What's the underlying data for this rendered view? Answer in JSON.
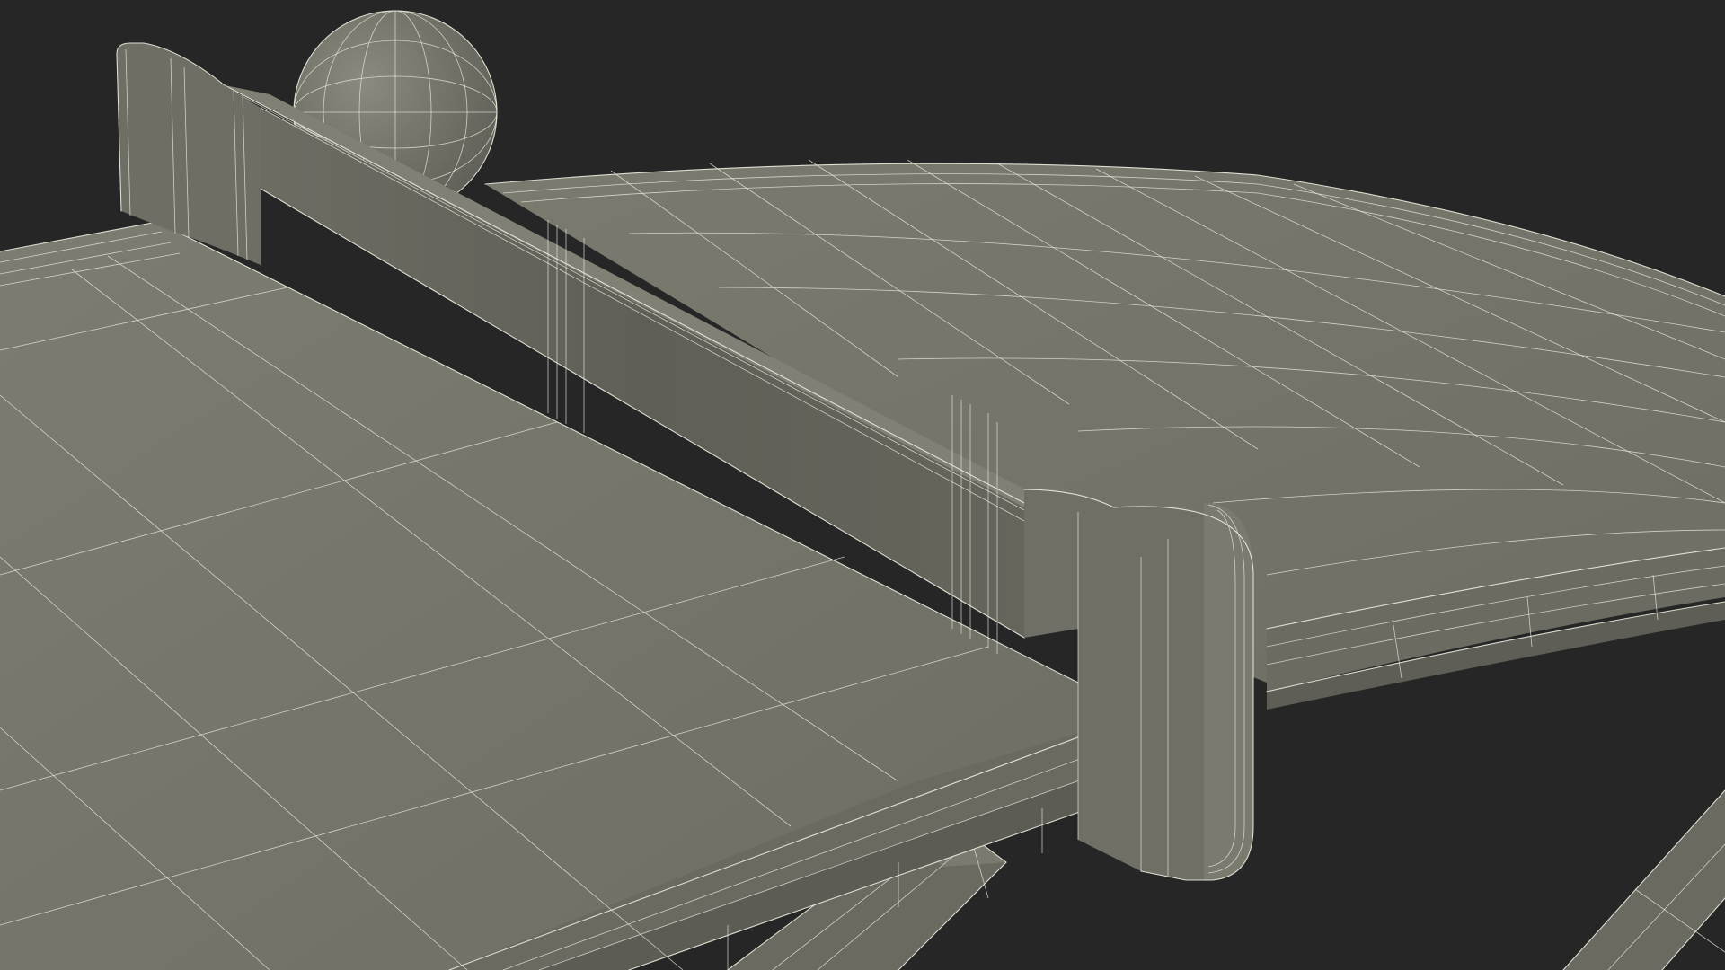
{
  "scene": {
    "background_color": "#262626",
    "surface_color": "#74746a",
    "surface_shadow_color": "#606058",
    "surface_highlight_color": "#828276",
    "wire_color": "#e9e9dc"
  }
}
